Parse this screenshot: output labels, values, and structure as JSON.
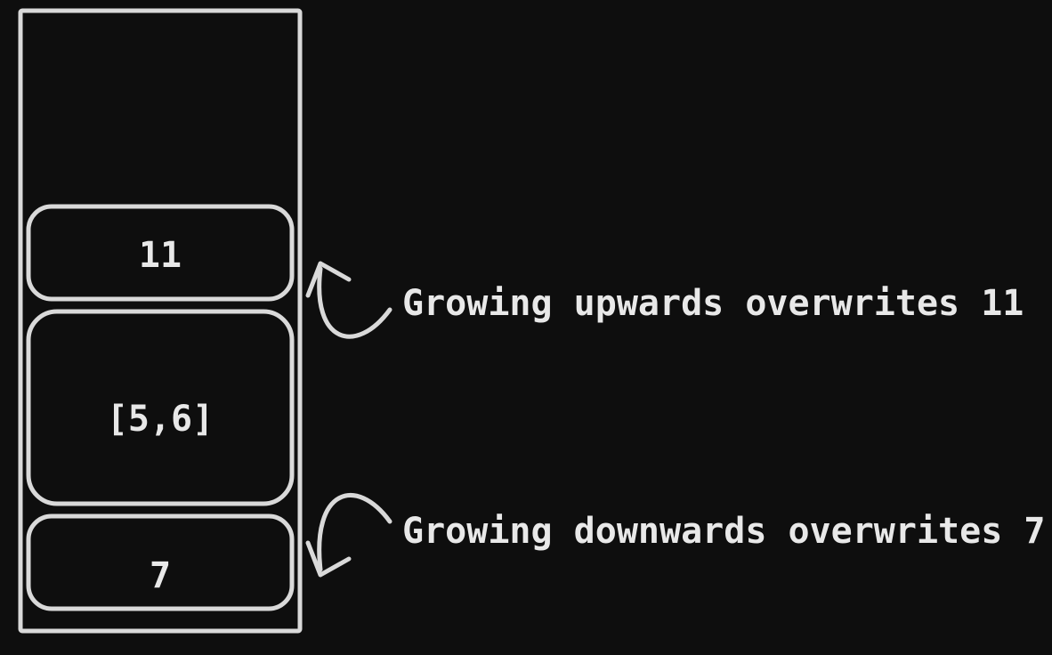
{
  "cells": {
    "top": "11",
    "middle": "[5,6]",
    "bottom": "7"
  },
  "annotations": {
    "upper": "Growing upwards overwrites 11",
    "lower": "Growing downwards overwrites 7"
  }
}
